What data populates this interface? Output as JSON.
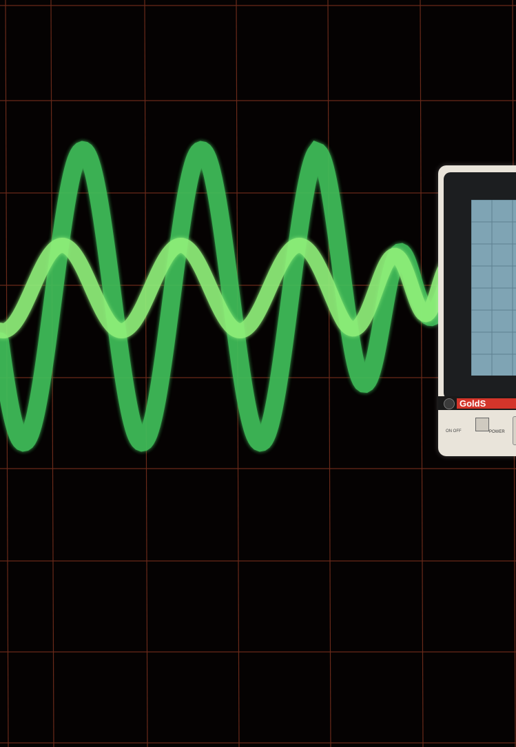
{
  "scene": {
    "description_hidden": false,
    "background_color": "#050202",
    "grid_color": "#6a2a1a",
    "trace_color": "#3fbf5a",
    "trace_color_light": "#8fef7a"
  },
  "oscilloscope": {
    "brand_text": "GoldS",
    "power_on_off_label": "ON OFF",
    "power_label": "POWER"
  },
  "icons": {
    "power_button": "square-button-icon",
    "indicator": "round-knob-icon"
  }
}
